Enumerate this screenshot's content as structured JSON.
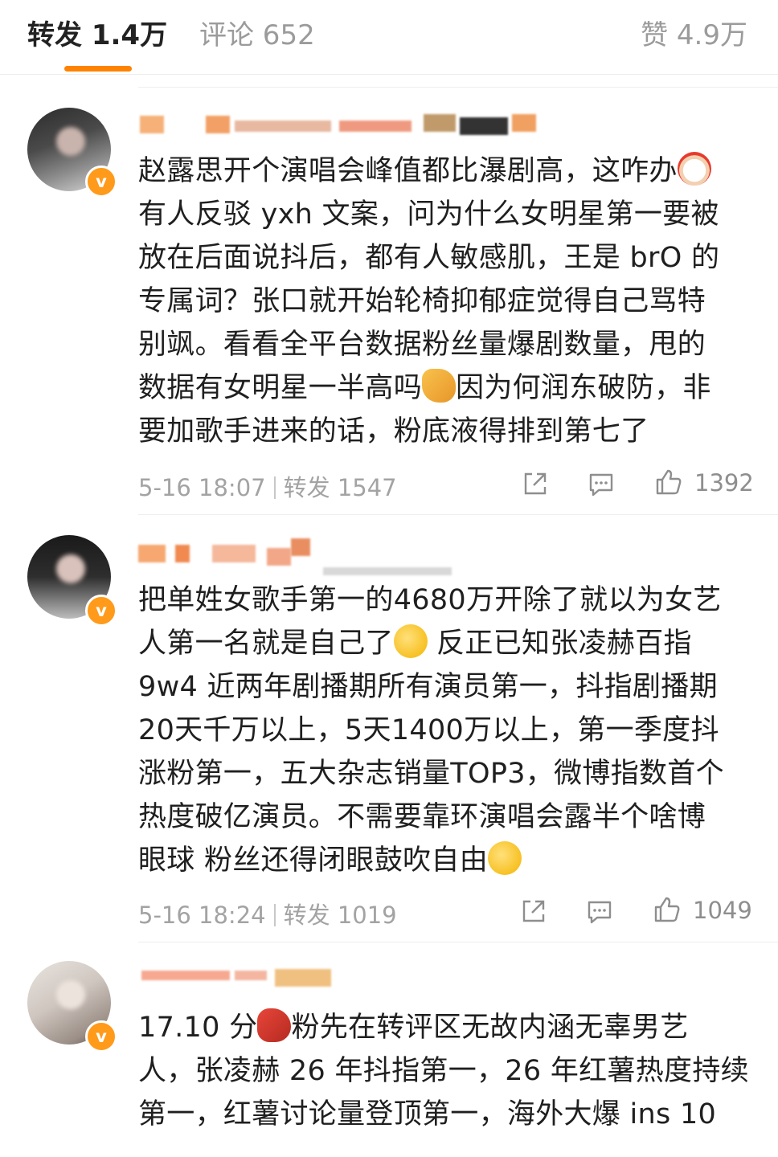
{
  "tabs": {
    "repost": "转发 1.4万",
    "comment": "评论 652",
    "like": "赞 4.9万"
  },
  "icons": [
    "share-icon",
    "comment-icon",
    "thumbs-up-icon",
    "verified-icon"
  ],
  "colors": {
    "accent": "#ff8200",
    "verified": "#ff9a1a",
    "meta": "#a3a3a3"
  },
  "comments": [
    {
      "text": "赵露思开个演唱会峰值都比瀑剧高，这咋办",
      "text2": "有人反驳 yxh 文案，问为什么女明星第一要被\n放在后面说抖后，都有人敏感肌，王是 brO 的\n专属词？张口就开始轮椅抑郁症觉得自己骂特\n别飒。看看全平台数据粉丝量爆剧数量，甩的\n数据有女明星一半高吗",
      "text3": "因为何润东破防，非\n要加歌手进来的话，粉底液得排到第七了",
      "time": "5-16 18:07",
      "reposts": "转发 1547",
      "likes": "1392"
    },
    {
      "text": "把单姓女歌手第一的4680万开除了就以为女艺\n人第一名就是自己了",
      "text2": " 反正已知张凌赫百指\n9w4 近两年剧播期所有演员第一，抖指剧播期\n20天千万以上，5天1400万以上，第一季度抖\n涨粉第一，五大杂志销量TOP3，微博指数首个\n热度破亿演员。不需要靠环演唱会露半个啥博\n眼球 粉丝还得闭眼鼓吹自由",
      "time": "5-16 18:24",
      "reposts": "转发 1019",
      "likes": "1049"
    },
    {
      "text": "17.10 分",
      "text2": "粉先在转评区无故内涵无辜男艺\n人，张凌赫 26 年抖指第一，26 年红薯热度持续\n第一，红薯讨论量登顶第一，海外大爆 ins 10"
    }
  ]
}
